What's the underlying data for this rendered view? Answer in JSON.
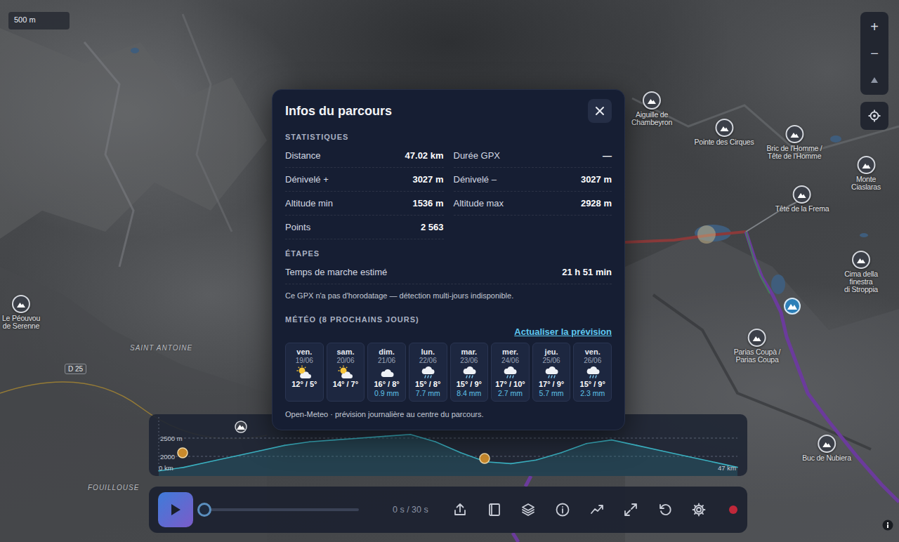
{
  "map": {
    "scale": "500 m",
    "zoom_in": "+",
    "zoom_out": "−",
    "peaks": [
      {
        "label": "Aiguille de\nChambeyron"
      },
      {
        "label": "Pointe des Cirques"
      },
      {
        "label": "Bric de l'Homme /\nTête de l'Homme"
      },
      {
        "label": "Monte Ciaslaras"
      },
      {
        "label": "Tête de la Frema"
      },
      {
        "label": "Cima della finestra\ndi Stroppia"
      },
      {
        "label": "Parias Coupà /\nParias Coupa"
      },
      {
        "label": "Buc de Nubiera"
      },
      {
        "label": "Le Péouvou\nde Serenne"
      }
    ],
    "places": [
      "SAINT ANTOINE",
      "FOUILLOUSE"
    ],
    "road": "D 25"
  },
  "profile": {
    "ticks": [
      "2500 m",
      "2000",
      "0 km",
      "47 km"
    ],
    "elevations": [
      1600,
      1700,
      1850,
      2000,
      2150,
      2300,
      2400,
      2450,
      2500,
      2550,
      2600,
      2400,
      2100,
      1850,
      1800,
      1900,
      2100,
      2350,
      2450,
      2300,
      2150,
      2000,
      1850,
      1700
    ]
  },
  "player": {
    "level": 0,
    "time": "0 s / 30 s"
  },
  "modal": {
    "title": "Infos du parcours",
    "stats_heading": "STATISTIQUES",
    "stats": [
      {
        "label": "Distance",
        "value": "47.02 km"
      },
      {
        "label": "Durée GPX",
        "value": "—"
      },
      {
        "label": "Dénivelé +",
        "value": "3027 m"
      },
      {
        "label": "Dénivelé –",
        "value": "3027 m"
      },
      {
        "label": "Altitude min",
        "value": "1536 m"
      },
      {
        "label": "Altitude max",
        "value": "2928 m"
      },
      {
        "label": "Points",
        "value": "2 563"
      }
    ],
    "stages_heading": "ÉTAPES",
    "walk_time": {
      "label": "Temps de marche estimé",
      "value": "21 h 51 min"
    },
    "note": "Ce GPX n'a pas d'horodatage — détection multi-jours indisponible.",
    "weather_heading": "MÉTÉO (8 PROCHAINS JOURS)",
    "refresh": "Actualiser la prévision",
    "days": [
      {
        "day": "ven.",
        "date": "19/06",
        "kind": "sun-cloud",
        "temps": "12° / 5°"
      },
      {
        "day": "sam.",
        "date": "20/06",
        "kind": "sun-cloud",
        "temps": "14° / 7°"
      },
      {
        "day": "dim.",
        "date": "21/06",
        "kind": "cloud",
        "temps": "16° / 8°",
        "precip": "0.9 mm"
      },
      {
        "day": "lun.",
        "date": "22/06",
        "kind": "rain",
        "temps": "15° / 8°",
        "precip": "7.7 mm"
      },
      {
        "day": "mar.",
        "date": "23/06",
        "kind": "rain",
        "temps": "15° / 9°",
        "precip": "8.4 mm"
      },
      {
        "day": "mer.",
        "date": "24/06",
        "kind": "rain",
        "temps": "17° / 10°",
        "precip": "2.7 mm"
      },
      {
        "day": "jeu.",
        "date": "25/06",
        "kind": "rain",
        "temps": "17° / 9°",
        "precip": "5.7 mm"
      },
      {
        "day": "ven.",
        "date": "26/06",
        "kind": "rain",
        "temps": "15° / 9°",
        "precip": "2.3 mm"
      }
    ],
    "footer": "Open-Meteo · prévision journalière au centre du parcours."
  }
}
